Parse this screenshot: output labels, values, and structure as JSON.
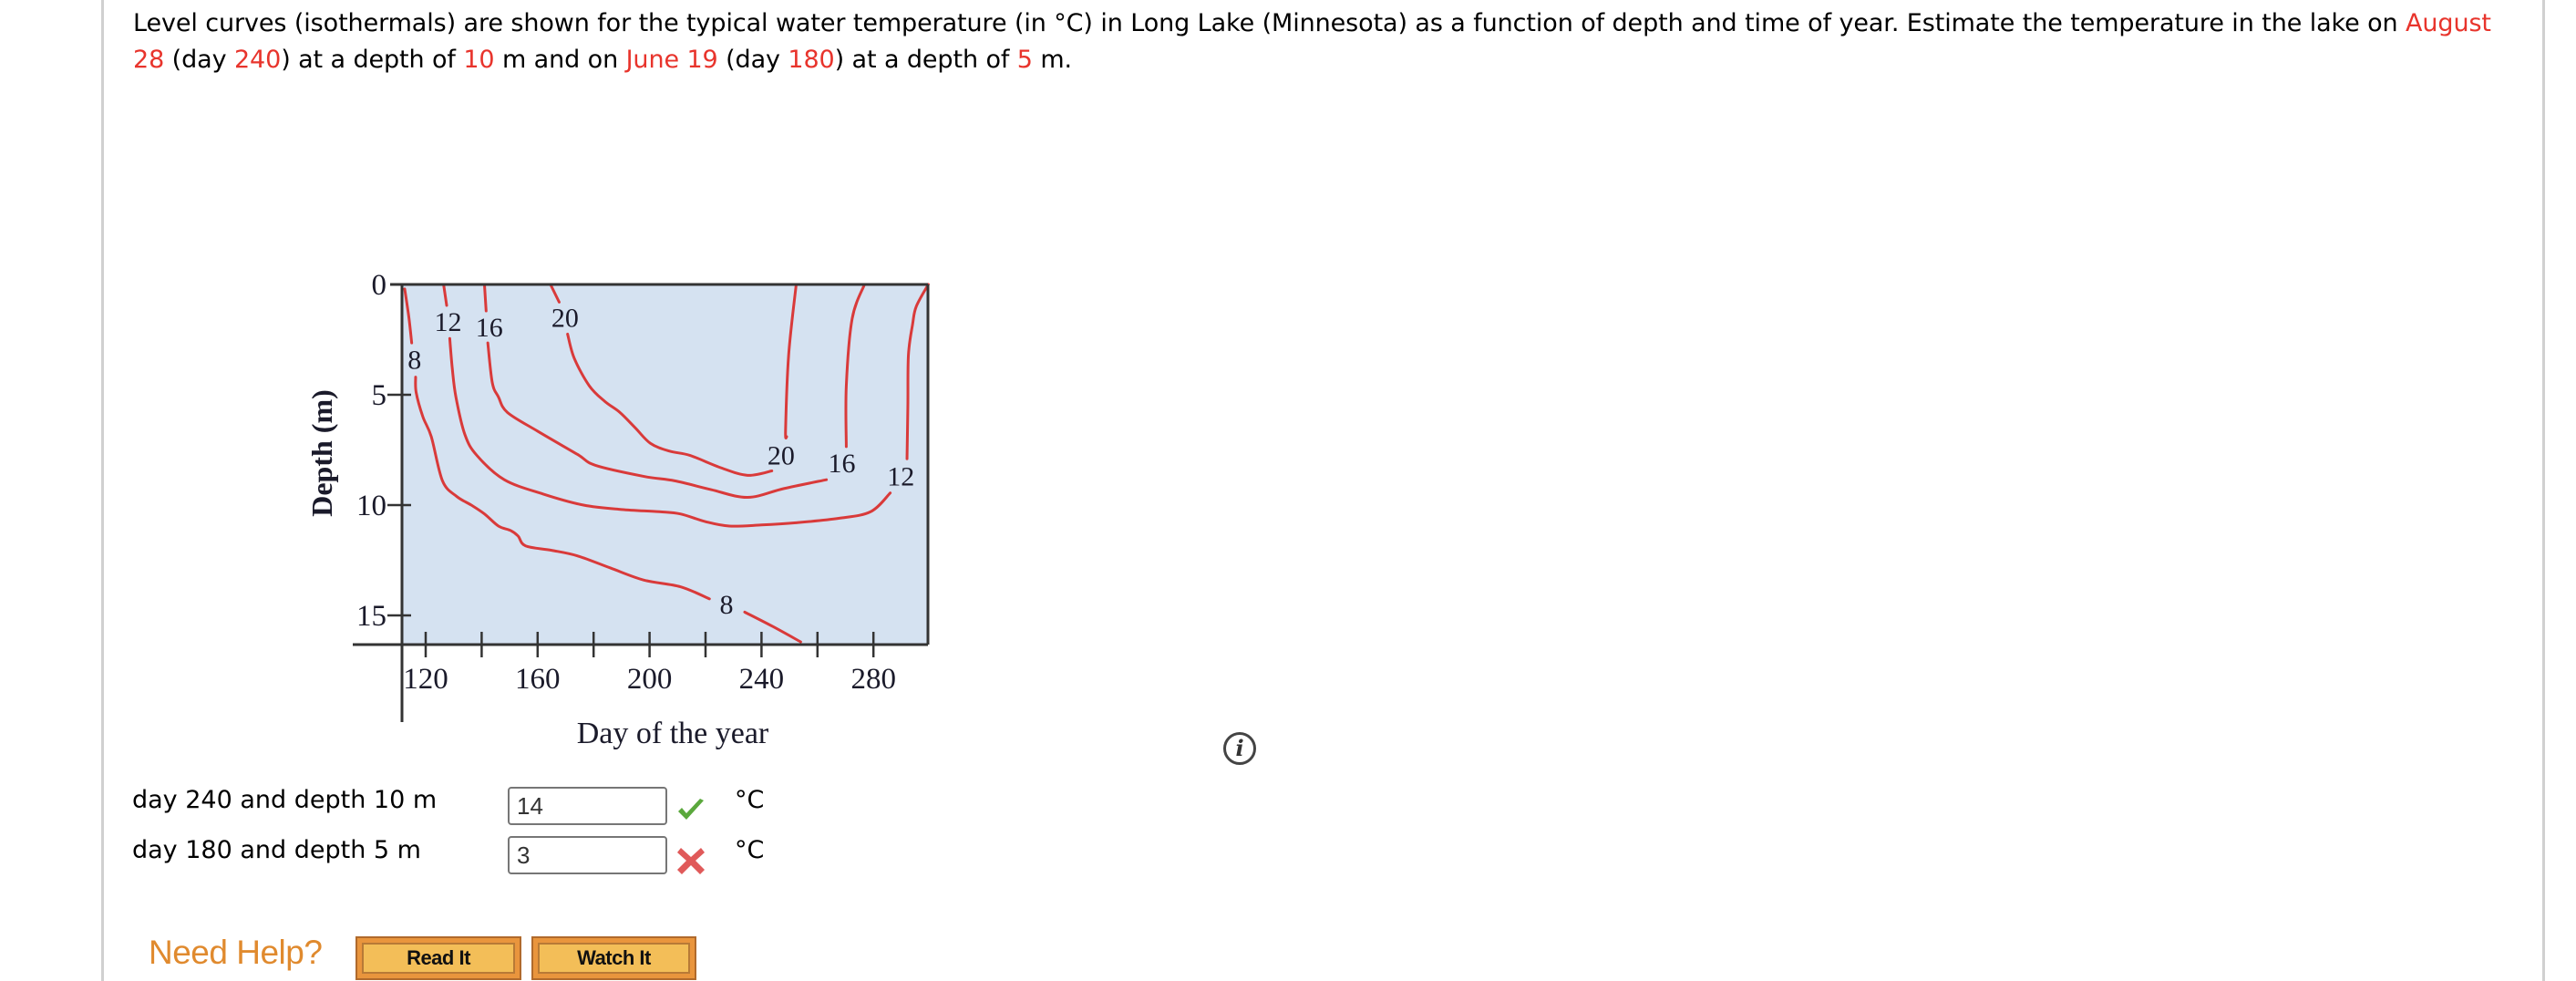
{
  "question": {
    "part1": "Level curves (isothermals) are shown for the typical water temperature (in °C) in Long Lake (Minnesota) as a function of depth and time of year. Estimate the temperature in the lake on ",
    "date1": "August 28",
    "part2": " (day ",
    "day1": "240",
    "part3": ") at a depth of ",
    "depth1": "10",
    "part4": " m and on ",
    "date2": "June 19",
    "part5": " (day ",
    "day2": "180",
    "part6": ") at a depth of ",
    "depth2": "5",
    "part7": " m."
  },
  "colors": {
    "highlight": "#e8342c",
    "plot_background": "#d5e2f1",
    "contour": "#d93a3a",
    "correct": "#5aa83c",
    "incorrect": "#e05a5a",
    "need_help": "#e08a2e"
  },
  "chart_data": {
    "type": "contour",
    "title": "",
    "xlabel": "Day of the year",
    "ylabel": "Depth (m)",
    "xlim": [
      111.5,
      300.5
    ],
    "ylim": [
      0,
      16.4
    ],
    "y_inverted": true,
    "grid": false,
    "x_ticks": [
      120,
      140,
      160,
      180,
      200,
      220,
      240,
      260,
      280
    ],
    "x_tick_labels": [
      {
        "value": 120,
        "label": "120"
      },
      {
        "value": 160,
        "label": "160"
      },
      {
        "value": 200,
        "label": "200"
      },
      {
        "value": 240,
        "label": "240"
      },
      {
        "value": 280,
        "label": "280"
      }
    ],
    "y_ticks": [
      0,
      5,
      10,
      15
    ],
    "y_tick_labels": [
      "0",
      "5",
      "10",
      "15"
    ],
    "series": [
      {
        "name": "8",
        "level": 8,
        "segments": [
          [
            [
              112.5,
              0.2
            ],
            [
              114,
              1.5
            ],
            [
              115,
              2.65
            ]
          ],
          [
            [
              116.4,
              4.2
            ],
            [
              116.6,
              4.9
            ],
            [
              119,
              6.0
            ],
            [
              122,
              6.9
            ],
            [
              126,
              8.9
            ],
            [
              131,
              9.6
            ],
            [
              136.3,
              10.0
            ],
            [
              141,
              10.4
            ],
            [
              146,
              10.95
            ],
            [
              150.3,
              11.15
            ],
            [
              153,
              11.4
            ],
            [
              155.7,
              11.85
            ],
            [
              165,
              12.05
            ],
            [
              174.2,
              12.3
            ],
            [
              186,
              12.85
            ],
            [
              198,
              13.4
            ],
            [
              211,
              13.7
            ],
            [
              221.4,
              14.25
            ]
          ],
          [
            [
              234,
              14.85
            ],
            [
              244,
              15.5
            ],
            [
              254,
              16.2
            ]
          ]
        ],
        "labels": [
          {
            "text": "8",
            "day": 116,
            "depth": 3.4
          },
          {
            "text": "8",
            "day": 227.5,
            "depth": 14.5
          }
        ]
      },
      {
        "name": "12",
        "level": 12,
        "segments": [
          [
            [
              126.4,
              0
            ],
            [
              127.5,
              0.95
            ]
          ],
          [
            [
              128.6,
              2.45
            ],
            [
              129.5,
              3.8
            ],
            [
              130.8,
              5.1
            ],
            [
              134,
              6.8
            ],
            [
              138.3,
              7.75
            ],
            [
              148.1,
              8.85
            ],
            [
              162,
              9.5
            ],
            [
              176.4,
              10.0
            ],
            [
              190,
              10.2
            ],
            [
              203.5,
              10.3
            ],
            [
              211,
              10.4
            ],
            [
              220,
              10.75
            ],
            [
              228.5,
              10.95
            ],
            [
              240,
              10.9
            ],
            [
              252.3,
              10.8
            ],
            [
              267.6,
              10.6
            ],
            [
              279,
              10.3
            ],
            [
              286,
              9.45
            ]
          ],
          [
            [
              292,
              7.9
            ],
            [
              292.3,
              5.5
            ],
            [
              292.5,
              3.2
            ],
            [
              294,
              1.8
            ],
            [
              295.3,
              1.0
            ],
            [
              299.6,
              0
            ]
          ]
        ],
        "labels": [
          {
            "text": "12",
            "day": 128,
            "depth": 1.7
          },
          {
            "text": "12",
            "day": 289.8,
            "depth": 8.7
          }
        ]
      },
      {
        "name": "16",
        "level": 16,
        "segments": [
          [
            [
              141,
              0
            ],
            [
              141.6,
              1.2
            ]
          ],
          [
            [
              142.2,
              2.65
            ],
            [
              143.8,
              4.45
            ],
            [
              146,
              5.1
            ],
            [
              149.2,
              5.8
            ],
            [
              160,
              6.65
            ],
            [
              174.2,
              7.7
            ],
            [
              180.7,
              8.2
            ],
            [
              198,
              8.7
            ],
            [
              209,
              8.9
            ],
            [
              222,
              9.3
            ],
            [
              235,
              9.65
            ],
            [
              248,
              9.25
            ],
            [
              263.2,
              8.85
            ]
          ],
          [
            [
              270.3,
              7.35
            ],
            [
              270.3,
              4.6
            ],
            [
              272.4,
              1.55
            ],
            [
              276.8,
              0
            ]
          ]
        ],
        "labels": [
          {
            "text": "16",
            "day": 142.7,
            "depth": 1.95
          },
          {
            "text": "16",
            "day": 268.7,
            "depth": 8.1
          }
        ]
      },
      {
        "name": "20",
        "level": 20,
        "segments": [
          [
            [
              164.6,
              0
            ],
            [
              167.7,
              0.8
            ]
          ],
          [
            [
              170.7,
              2.25
            ],
            [
              173.1,
              3.35
            ],
            [
              178.5,
              4.6
            ],
            [
              184,
              5.3
            ],
            [
              189.4,
              5.8
            ],
            [
              194.9,
              6.5
            ],
            [
              200.3,
              7.2
            ],
            [
              207,
              7.55
            ],
            [
              214.5,
              7.75
            ],
            [
              225.3,
              8.3
            ],
            [
              235,
              8.65
            ],
            [
              243.7,
              8.45
            ]
          ],
          [
            [
              249,
              6.9
            ],
            [
              248.6,
              6.6
            ],
            [
              249.7,
              3.2
            ],
            [
              252.4,
              0
            ]
          ]
        ],
        "labels": [
          {
            "text": "20",
            "day": 169.8,
            "depth": 1.5
          },
          {
            "text": "20",
            "day": 247,
            "depth": 7.75
          }
        ]
      }
    ]
  },
  "answers": [
    {
      "label": "day 240 and depth 10 m",
      "value": "14",
      "status": "correct",
      "unit": "°C"
    },
    {
      "label": "day 180 and depth 5 m",
      "value": "3",
      "status": "incorrect",
      "unit": "°C"
    }
  ],
  "help": {
    "title": "Need Help?",
    "read_it": "Read It",
    "watch_it": "Watch It"
  },
  "info_icon": "info-icon"
}
